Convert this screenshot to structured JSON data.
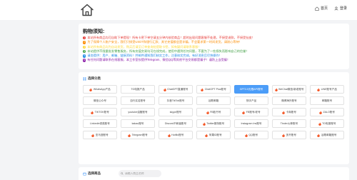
{
  "nav": {
    "home": "首页",
    "login": "登录"
  },
  "notice": {
    "title": "购物须知:",
    "items": [
      {
        "num": "1",
        "color": "#e53935",
        "text": "本站所有商品均可自助下单提现！所有卡密下单空请五分钟内核验商品！超时出现问题客服不处理，不接受退款，不接受扯皮！"
      },
      {
        "num": "2",
        "color": "#fb8c00",
        "text": "为了保障个人账户安全，我们只接受USDT和银行汇款、其它充值都会是诈骗，不会要求第一时间发货，请耐心等待！"
      },
      {
        "num": "3",
        "color": "#fdd835",
        "text": "本站所有商品均为自动发货，购买后请至订单查询处提取卡密，如有疑问请联系客服！"
      },
      {
        "num": "4",
        "color": "#43a047",
        "text": "本站提供不限量批发零售服务，所有充值交易均可在线完成，使用中遇到任何问题，不要为了一些损失而影响自己的信誉！"
      },
      {
        "num": "5",
        "color": "#1e88e5",
        "text": "请务提供：用户、邮箱、链接资料！并邮件通知我们核实工作，注意核实完成，有好消息后尽快操作！"
      },
      {
        "num": "6",
        "color": "#8e24aa",
        "text": "有任何问题请联系在线客服，本工作室仅提供Telegram、微信QQ等其他平台交易都是骗子！谨防上当受骗！"
      }
    ]
  },
  "categories": {
    "title": "选择分类",
    "items": [
      {
        "label": "WhatsApp产品",
        "hot": true,
        "active": false
      },
      {
        "label": "TG电报产品",
        "hot": false,
        "active": false
      },
      {
        "label": "ChatGPT直通账号",
        "hot": true,
        "active": false
      },
      {
        "label": "ChatGPT Plus账号",
        "hot": true,
        "active": false
      },
      {
        "label": "GPT3.5无限API账号",
        "hot": false,
        "active": true
      },
      {
        "label": "WeChat微信/新老账号",
        "hot": true,
        "active": false
      },
      {
        "label": "LINE账号产品",
        "hot": true,
        "active": false
      },
      {
        "label": "微信公众号",
        "hot": false,
        "active": false
      },
      {
        "label": "自行实名账号",
        "hot": false,
        "active": false
      },
      {
        "label": "抖音TikTok账号",
        "hot": false,
        "active": false
      },
      {
        "label": "谷歌邮箱",
        "hot": false,
        "active": false
      },
      {
        "label": "快手产品",
        "hot": false,
        "active": false
      },
      {
        "label": "微博海外账号",
        "hot": false,
        "active": false
      },
      {
        "label": "邮箱账号",
        "hot": false,
        "active": false
      },
      {
        "label": "TIKTOK账号",
        "hot": true,
        "active": false
      },
      {
        "label": "youtube油管账号",
        "hot": false,
        "active": false
      },
      {
        "label": "skype账号",
        "hot": false,
        "active": false
      },
      {
        "label": "FB脸书号",
        "hot": true,
        "active": false
      },
      {
        "label": "FB账号/老号",
        "hot": true,
        "active": false
      },
      {
        "label": "卡商账号",
        "hot": true,
        "active": false
      },
      {
        "label": "ZALO账号",
        "hot": true,
        "active": false
      },
      {
        "label": "Linkedin领英账号",
        "hot": false,
        "active": false
      },
      {
        "label": "kakao账号",
        "hot": false,
        "active": false
      },
      {
        "label": "Discord不和谐账号",
        "hot": false,
        "active": false
      },
      {
        "label": "Twitter推特账号",
        "hot": true,
        "active": false
      },
      {
        "label": "Instagram Ins账号",
        "hot": false,
        "active": false
      },
      {
        "label": "Tinder火种账号",
        "hot": false,
        "active": false
      },
      {
        "label": "TG电报账号",
        "hot": true,
        "active": false
      },
      {
        "label": "亚马逊账号",
        "hot": true,
        "active": false
      },
      {
        "label": "Telegram账号",
        "hot": true,
        "active": false
      },
      {
        "label": "Hotflix账号",
        "hot": true,
        "active": false
      },
      {
        "label": "苹果ID账号",
        "hot": true,
        "active": false
      },
      {
        "label": "QQ账号",
        "hot": true,
        "active": false
      },
      {
        "label": "多开账号",
        "hot": true,
        "active": false
      },
      {
        "label": "谷歌邮箱账号",
        "hot": true,
        "active": false
      }
    ]
  },
  "products": {
    "title": "选择商品",
    "search_placeholder": "请输入商品名称"
  },
  "colors": {
    "accent": "#4c9df8",
    "flame": "#f4511e",
    "background": "#f3f4f6"
  }
}
